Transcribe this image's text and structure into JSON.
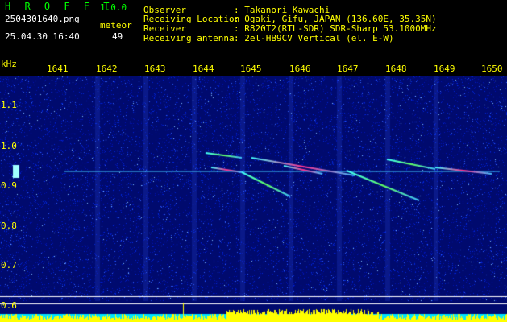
{
  "header": {
    "app_name": "H R O F F T",
    "version": "1.0.0",
    "filename": "2504301640.png",
    "datetime": "25.04.30 16:40",
    "counter_label": "meteor",
    "counter_value": "49"
  },
  "info": {
    "rows": [
      {
        "label": "Observer",
        "value": ": Takanori Kawachi"
      },
      {
        "label": "Receiving Location",
        "value": ": Ogaki, Gifu, JAPAN (136.60E, 35.35N)"
      },
      {
        "label": "Receiver",
        "value": ": R820T2(RTL-SDR) SDR-Sharp 53.1000MHz"
      },
      {
        "label": "Receiving antenna",
        "value": ": 2el-HB9CV Vertical (el. E-W)"
      }
    ]
  },
  "axis": {
    "unit": "kHz",
    "time_ticks": [
      "1641",
      "1642",
      "1643",
      "1644",
      "1645",
      "1646",
      "1647",
      "1648",
      "1649",
      "1650"
    ],
    "freq_ticks": [
      "1.1",
      "1.0",
      "0.9",
      "0.8",
      "0.7",
      "0.6"
    ]
  },
  "colors": {
    "background": "#000000",
    "spectrum_base": "#000a78",
    "header_text": "#ffff00",
    "title_green": "#00ff00",
    "amplitude_bars": "#ffff00",
    "amplitude_floor": "#00e5ff"
  }
}
